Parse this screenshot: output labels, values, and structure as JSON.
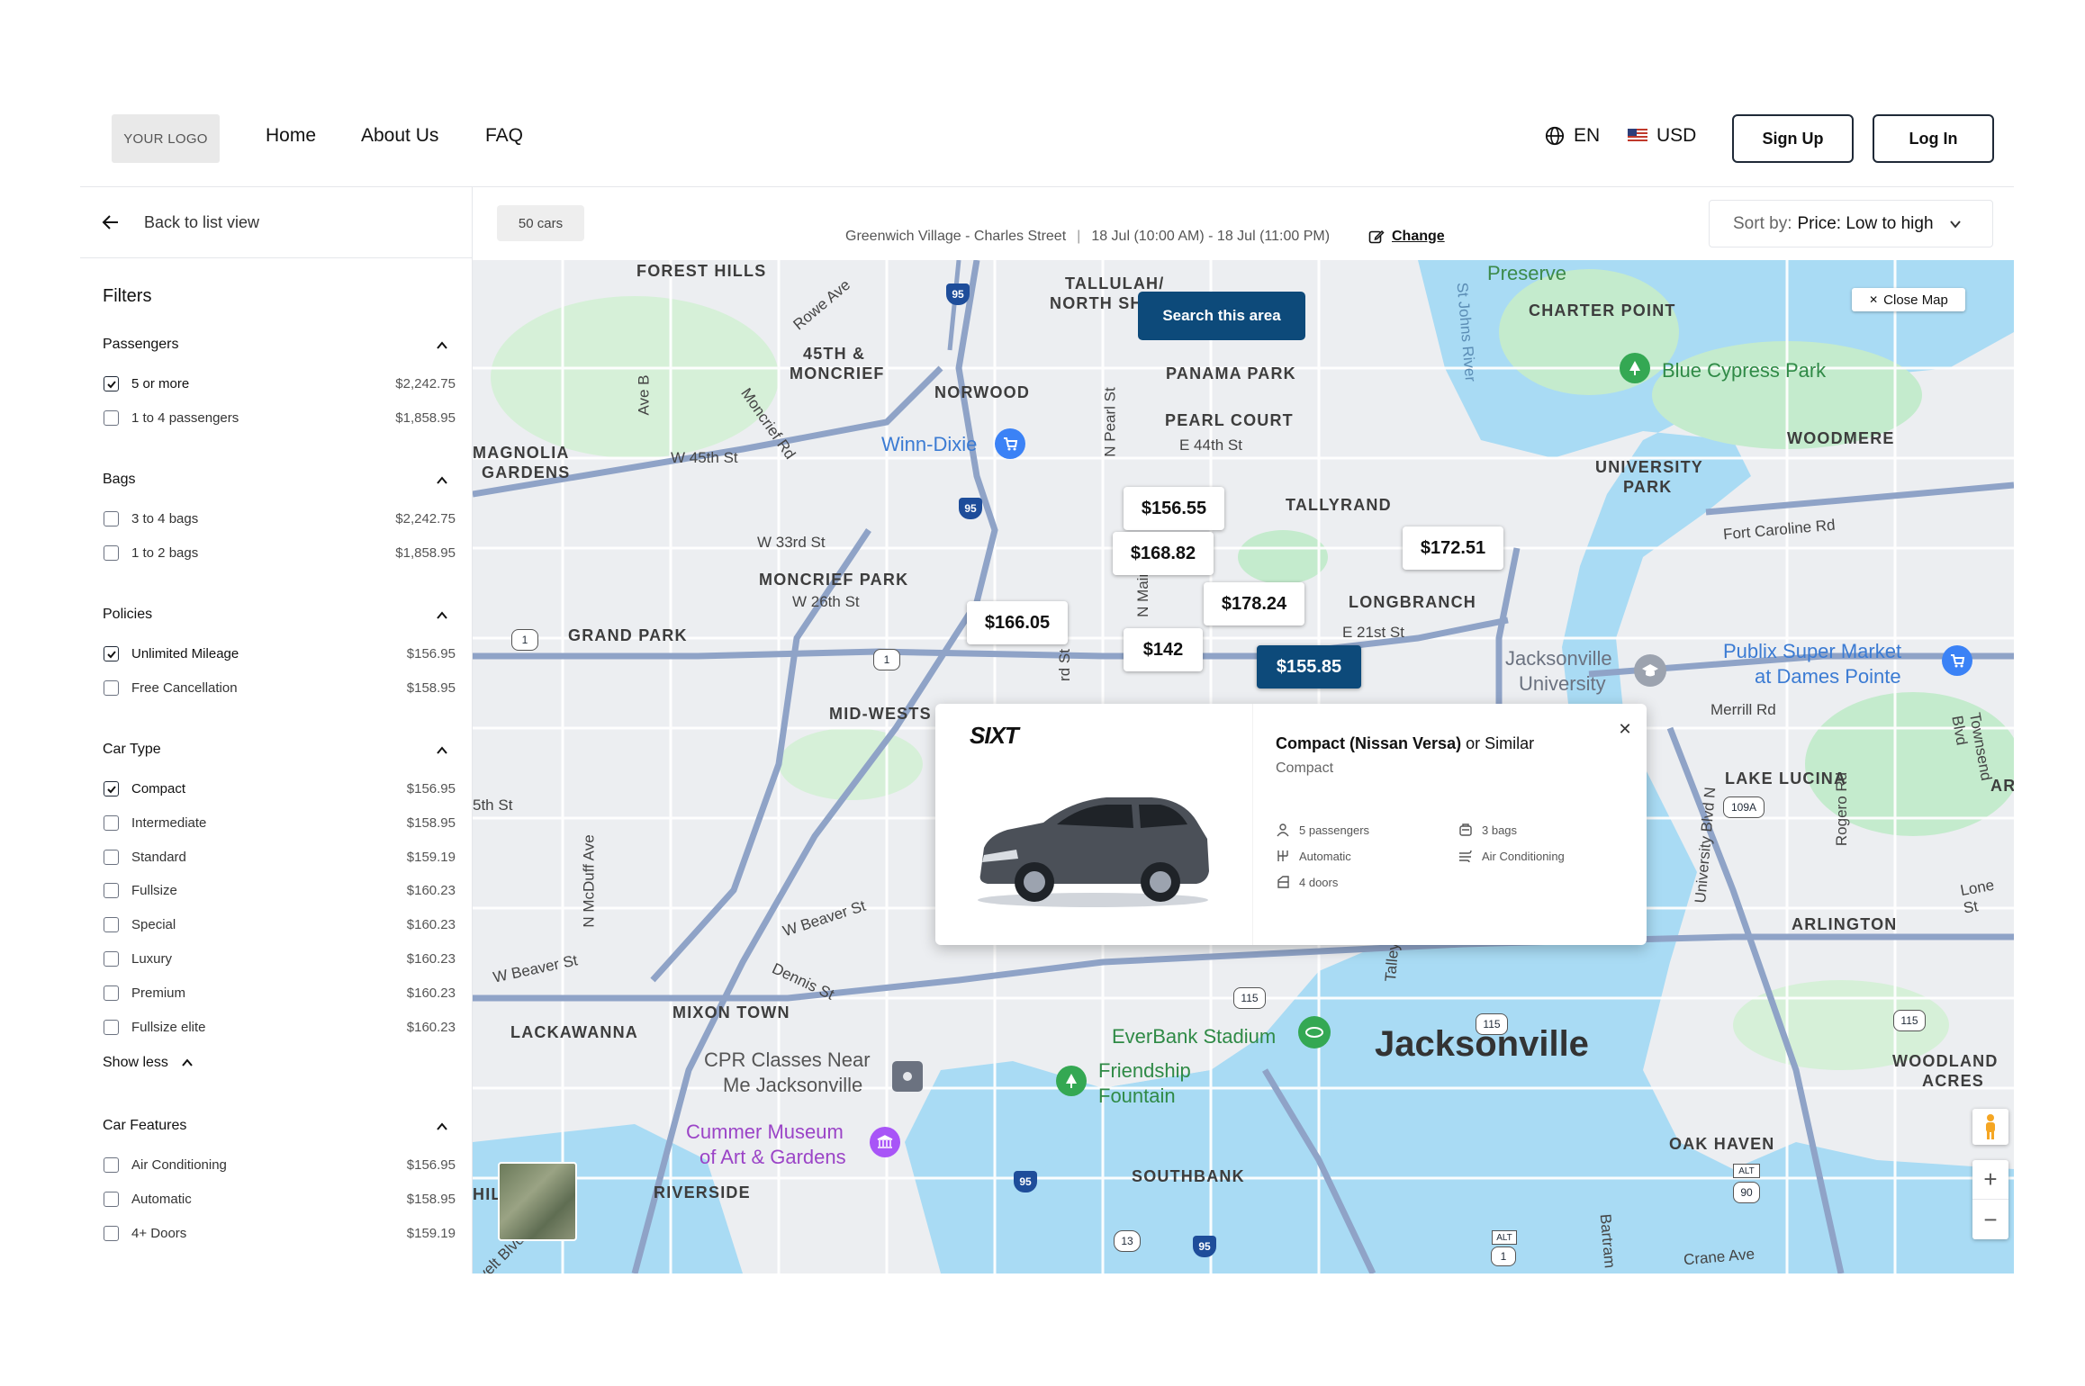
{
  "header": {
    "logo": "YOUR LOGO",
    "nav": [
      "Home",
      "About Us",
      "FAQ"
    ],
    "language": "EN",
    "currency": "USD",
    "signup": "Sign Up",
    "login": "Log In"
  },
  "sidebar": {
    "back": "Back to list view",
    "filters_title": "Filters",
    "show_less": "Show less",
    "sections": [
      {
        "title": "Passengers",
        "options": [
          {
            "label": "5 or more",
            "price": "$2,242.75",
            "checked": true
          },
          {
            "label": "1 to 4 passengers",
            "price": "$1,858.95",
            "checked": false
          }
        ]
      },
      {
        "title": "Bags",
        "options": [
          {
            "label": "3 to 4 bags",
            "price": "$2,242.75",
            "checked": false
          },
          {
            "label": "1 to 2 bags",
            "price": "$1,858.95",
            "checked": false
          }
        ]
      },
      {
        "title": "Policies",
        "options": [
          {
            "label": "Unlimited Mileage",
            "price": "$156.95",
            "checked": true
          },
          {
            "label": "Free Cancellation",
            "price": "$158.95",
            "checked": false
          }
        ]
      },
      {
        "title": "Car Type",
        "options": [
          {
            "label": "Compact",
            "price": "$156.95",
            "checked": true
          },
          {
            "label": "Intermediate",
            "price": "$158.95",
            "checked": false
          },
          {
            "label": "Standard",
            "price": "$159.19",
            "checked": false
          },
          {
            "label": "Fullsize",
            "price": "$160.23",
            "checked": false
          },
          {
            "label": "Special",
            "price": "$160.23",
            "checked": false
          },
          {
            "label": "Luxury",
            "price": "$160.23",
            "checked": false
          },
          {
            "label": "Premium",
            "price": "$160.23",
            "checked": false
          },
          {
            "label": "Fullsize elite",
            "price": "$160.23",
            "checked": false
          }
        ]
      },
      {
        "title": "Car Features",
        "options": [
          {
            "label": "Air Conditioning",
            "price": "$156.95",
            "checked": false
          },
          {
            "label": "Automatic",
            "price": "$158.95",
            "checked": false
          },
          {
            "label": "4+ Doors",
            "price": "$159.19",
            "checked": false
          }
        ]
      }
    ]
  },
  "topbar": {
    "count": "50 cars",
    "location": "Greenwich Village - Charles Street",
    "dates": "18 Jul (10:00 AM) - 18 Jul (11:00 PM)",
    "change": "Change",
    "sort_label": "Sort by:",
    "sort_value": "Price: Low to high"
  },
  "map": {
    "search_area": "Search this area",
    "close_map": "Close Map",
    "prices": [
      "$156.55",
      "$168.82",
      "$178.24",
      "$166.05",
      "$142",
      "$155.85",
      "$172.51"
    ],
    "neighborhoods": [
      "FOREST HILLS",
      "TALLULAH/",
      "NORTH SH",
      "45TH &",
      "MONCRIEF",
      "NORWOOD",
      "PANAMA PARK",
      "PEARL COURT",
      "MAGNOLIA",
      "GARDENS",
      "TALLYRAND",
      "MONCRIEF PARK",
      "GRAND PARK",
      "LONGBRANCH",
      "MID-WESTS",
      "CHARTER POINT",
      "WOODMERE",
      "UNIVERSITY",
      "PARK",
      "LAKE LUCINA",
      "ARLINGTON",
      "LACKAWANNA",
      "MIXON TOWN",
      "RIVERSIDE",
      "SOUTHBANK",
      "OAK HAVEN",
      "WOODLAND",
      "ACRES",
      "AR",
      "HIL"
    ],
    "streets": [
      "Rowe Ave",
      "Ave B",
      "W 45th St",
      "Moncrief Rd",
      "N Pearl St",
      "E 44th St",
      "W 33rd St",
      "W 26th St",
      "N Main",
      "E 21st St",
      "Fort Caroline Rd",
      "Merrill Rd",
      "Townsend Blvd",
      "Rogero Rd",
      "Lone St",
      "University Blvd N",
      "5th St",
      "N McDuff Ave",
      "W Beaver St",
      "W Beaver St",
      "Dennis St",
      "Talley",
      "Crane Ave",
      "Bartram",
      "velt Blvd",
      "St Johns River",
      "rd St"
    ],
    "pois": [
      "Preserve",
      "Blue Cypress Park",
      "Winn-Dixie",
      "Jacksonville",
      "University",
      "Publix Super Market",
      "at Dames Pointe",
      "EverBank Stadium",
      "Friendship",
      "Fountain",
      "CPR Classes Near",
      "Me Jacksonville",
      "Cummer Museum",
      "of Art & Gardens"
    ],
    "city": "Jacksonville",
    "shields": [
      "95",
      "95",
      "95",
      "95",
      "1",
      "1",
      "115",
      "115",
      "115",
      "109A",
      "13",
      "1",
      "90",
      "ALT",
      "ALT"
    ],
    "zoom_in": "+",
    "zoom_out": "−"
  },
  "car_card": {
    "brand": "SIXT",
    "model": "Compact (Nissan Versa)",
    "similar": "or Similar",
    "category": "Compact",
    "specs": [
      "5 passengers",
      "3 bags",
      "Automatic",
      "Air Conditioning",
      "4 doors"
    ]
  }
}
